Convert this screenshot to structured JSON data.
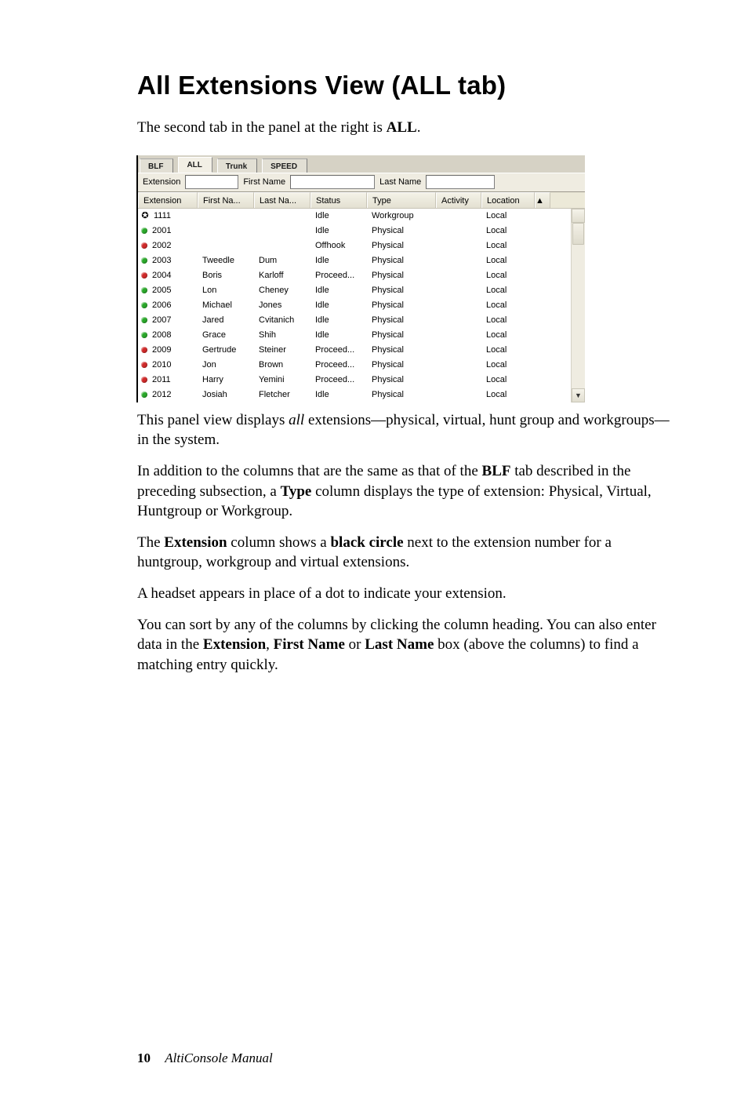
{
  "title": "All Extensions View (ALL tab)",
  "intro_pre": "The second tab in the panel at the right is ",
  "intro_bold": "ALL",
  "intro_post": ".",
  "panel": {
    "tabs": [
      "BLF",
      "ALL",
      "Trunk",
      "SPEED"
    ],
    "active_tab_index": 1,
    "search": {
      "extension_label": "Extension",
      "firstname_label": "First Name",
      "lastname_label": "Last Name"
    },
    "columns": [
      "Extension",
      "First Na...",
      "Last Na...",
      "Status",
      "Type",
      "Activity",
      "Location"
    ],
    "rows": [
      {
        "icon": "headset",
        "ext": "1111",
        "first": "",
        "last": "",
        "status": "Idle",
        "type": "Workgroup",
        "activity": "",
        "location": "Local"
      },
      {
        "icon": "green",
        "ext": "2001",
        "first": "",
        "last": "",
        "status": "Idle",
        "type": "Physical",
        "activity": "",
        "location": "Local"
      },
      {
        "icon": "red",
        "ext": "2002",
        "first": "",
        "last": "",
        "status": "Offhook",
        "type": "Physical",
        "activity": "",
        "location": "Local"
      },
      {
        "icon": "green",
        "ext": "2003",
        "first": "Tweedle",
        "last": "Dum",
        "status": "Idle",
        "type": "Physical",
        "activity": "",
        "location": "Local"
      },
      {
        "icon": "red",
        "ext": "2004",
        "first": "Boris",
        "last": "Karloff",
        "status": "Proceed...",
        "type": "Physical",
        "activity": "",
        "location": "Local"
      },
      {
        "icon": "green",
        "ext": "2005",
        "first": "Lon",
        "last": "Cheney",
        "status": "Idle",
        "type": "Physical",
        "activity": "",
        "location": "Local"
      },
      {
        "icon": "green",
        "ext": "2006",
        "first": "Michael",
        "last": "Jones",
        "status": "Idle",
        "type": "Physical",
        "activity": "",
        "location": "Local"
      },
      {
        "icon": "green",
        "ext": "2007",
        "first": "Jared",
        "last": "Cvitanich",
        "status": "Idle",
        "type": "Physical",
        "activity": "",
        "location": "Local"
      },
      {
        "icon": "green",
        "ext": "2008",
        "first": "Grace",
        "last": "Shih",
        "status": "Idle",
        "type": "Physical",
        "activity": "",
        "location": "Local"
      },
      {
        "icon": "red",
        "ext": "2009",
        "first": "Gertrude",
        "last": "Steiner",
        "status": "Proceed...",
        "type": "Physical",
        "activity": "",
        "location": "Local"
      },
      {
        "icon": "red",
        "ext": "2010",
        "first": "Jon",
        "last": "Brown",
        "status": "Proceed...",
        "type": "Physical",
        "activity": "",
        "location": "Local"
      },
      {
        "icon": "red",
        "ext": "2011",
        "first": "Harry",
        "last": "Yemini",
        "status": "Proceed...",
        "type": "Physical",
        "activity": "",
        "location": "Local"
      },
      {
        "icon": "green",
        "ext": "2012",
        "first": "Josiah",
        "last": "Fletcher",
        "status": "Idle",
        "type": "Physical",
        "activity": "",
        "location": "Local"
      }
    ]
  },
  "p_after_panel": {
    "pre": "This panel view displays ",
    "ital": "all",
    "post": " extensions—physical, virtual, hunt group and workgroups—in the system."
  },
  "p_type": {
    "a": "In addition to the columns that are the same as that of the ",
    "b": "BLF",
    "c": " tab described in the preceding subsection, a ",
    "d": "Type",
    "e": " column displays the type of extension: Physical, Virtual, Huntgroup or Workgroup."
  },
  "p_circle": {
    "a": "The ",
    "b": "Extension",
    "c": " column shows a ",
    "d": "black circle",
    "e": " next to the extension number for a huntgroup, workgroup and virtual extensions."
  },
  "p_headset": "A headset appears in place of a dot to indicate your extension.",
  "p_sort": {
    "a": "You can sort by any of the columns by clicking the column heading. You can also enter data in the ",
    "b": "Extension",
    "c": ", ",
    "d": "First Name",
    "e": " or ",
    "f": "Last Name",
    "g": " box (above the columns) to find a matching entry quickly."
  },
  "footer": {
    "page": "10",
    "book": "AltiConsole Manual"
  }
}
